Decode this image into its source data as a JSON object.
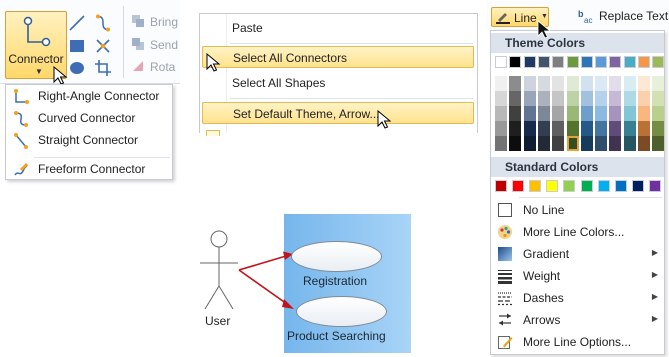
{
  "connector_panel": {
    "button_label": "Connector",
    "ribbon_disabled_items": [
      "Bring",
      "Send",
      "Rota"
    ],
    "menu_items": [
      {
        "icon": "right-angle-connector-icon",
        "label": "Right-Angle Connector"
      },
      {
        "icon": "curved-connector-icon",
        "label": "Curved Connector"
      },
      {
        "icon": "straight-connector-icon",
        "label": "Straight Connector"
      },
      {
        "icon": "freeform-connector-icon",
        "label": "Freeform Connector"
      }
    ]
  },
  "context_menu": {
    "items": [
      {
        "label": "Paste",
        "highlighted": false
      },
      {
        "label": "Select All Connectors",
        "highlighted": true
      },
      {
        "label": "Select All Shapes",
        "highlighted": false
      },
      {
        "label": "Set Default Theme, Arrow...",
        "highlighted": true
      }
    ]
  },
  "line_panel": {
    "button_label": "Line",
    "replace_text_label": "Replace Text",
    "theme_colors_header": "Theme Colors",
    "standard_colors_header": "Standard Colors",
    "theme_base_colors": [
      "#ffffff",
      "#000000",
      "#1f3864",
      "#44546a",
      "#7f7f7f",
      "#6d9a3c",
      "#2e75b6",
      "#5b9bd5",
      "#8064a2",
      "#4bacc6",
      "#f79646",
      "#9bbb59"
    ],
    "standard_colors": [
      "#c00000",
      "#ff0000",
      "#ffc000",
      "#ffff00",
      "#92d050",
      "#00b050",
      "#00b0f0",
      "#0070c0",
      "#002060",
      "#7030a0"
    ],
    "menu_items": [
      {
        "icon": "no-line-icon",
        "label": "No Line",
        "submenu": false
      },
      {
        "icon": "palette-icon",
        "label": "More Line Colors...",
        "submenu": false
      },
      {
        "icon": "gradient-icon",
        "label": "Gradient",
        "submenu": true
      },
      {
        "icon": "weight-icon",
        "label": "Weight",
        "submenu": true
      },
      {
        "icon": "dashes-icon",
        "label": "Dashes",
        "submenu": true
      },
      {
        "icon": "arrows-icon",
        "label": "Arrows",
        "submenu": true
      },
      {
        "icon": "more-line-options-icon",
        "label": "More Line Options...",
        "submenu": false
      }
    ]
  },
  "diagram": {
    "actor_label": "User",
    "use_cases": [
      "Registration",
      "Product Searching"
    ],
    "arrow_color": "#c0141c",
    "boundary_color": "#8ec5f2"
  }
}
